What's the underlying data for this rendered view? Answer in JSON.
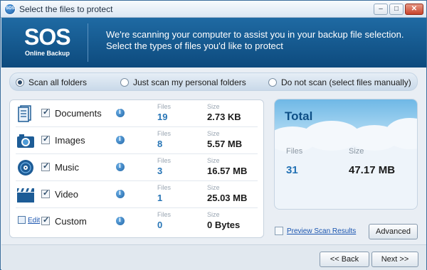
{
  "window": {
    "title": "Select the files to protect",
    "controls": {
      "minimize": "–",
      "maximize": "□",
      "close": "✕"
    }
  },
  "banner": {
    "logo_text": "SOS",
    "logo_subtitle": "Online Backup",
    "message": "We're scanning your computer to assist you in your backup file selection. Select the types of files you'd like to protect"
  },
  "scan_options": [
    {
      "label": "Scan all folders",
      "selected": true
    },
    {
      "label": "Just scan my personal folders",
      "selected": false
    },
    {
      "label": "Do not scan (select files manually)",
      "selected": false
    }
  ],
  "column_headers": {
    "files": "Files",
    "size": "Size"
  },
  "file_types": [
    {
      "label": "Documents",
      "files": "19",
      "size": "2.73 KB",
      "checked": true,
      "icon": "document-icon"
    },
    {
      "label": "Images",
      "files": "8",
      "size": "5.57 MB",
      "checked": true,
      "icon": "camera-icon"
    },
    {
      "label": "Music",
      "files": "3",
      "size": "16.57 MB",
      "checked": true,
      "icon": "music-disc-icon"
    },
    {
      "label": "Video",
      "files": "1",
      "size": "25.03 MB",
      "checked": true,
      "icon": "clapperboard-icon"
    },
    {
      "label": "Custom",
      "files": "0",
      "size": "0 Bytes",
      "checked": true,
      "icon": "edit-icon",
      "edit_label": "Edit"
    }
  ],
  "total": {
    "title": "Total",
    "files_label": "Files",
    "size_label": "Size",
    "files": "31",
    "size": "47.17 MB"
  },
  "links": {
    "preview": "Preview Scan Results"
  },
  "buttons": {
    "advanced": "Advanced",
    "back": "<< Back",
    "next": "Next >>"
  },
  "colors": {
    "banner": "#0d4a7d",
    "accent": "#2775b6"
  }
}
